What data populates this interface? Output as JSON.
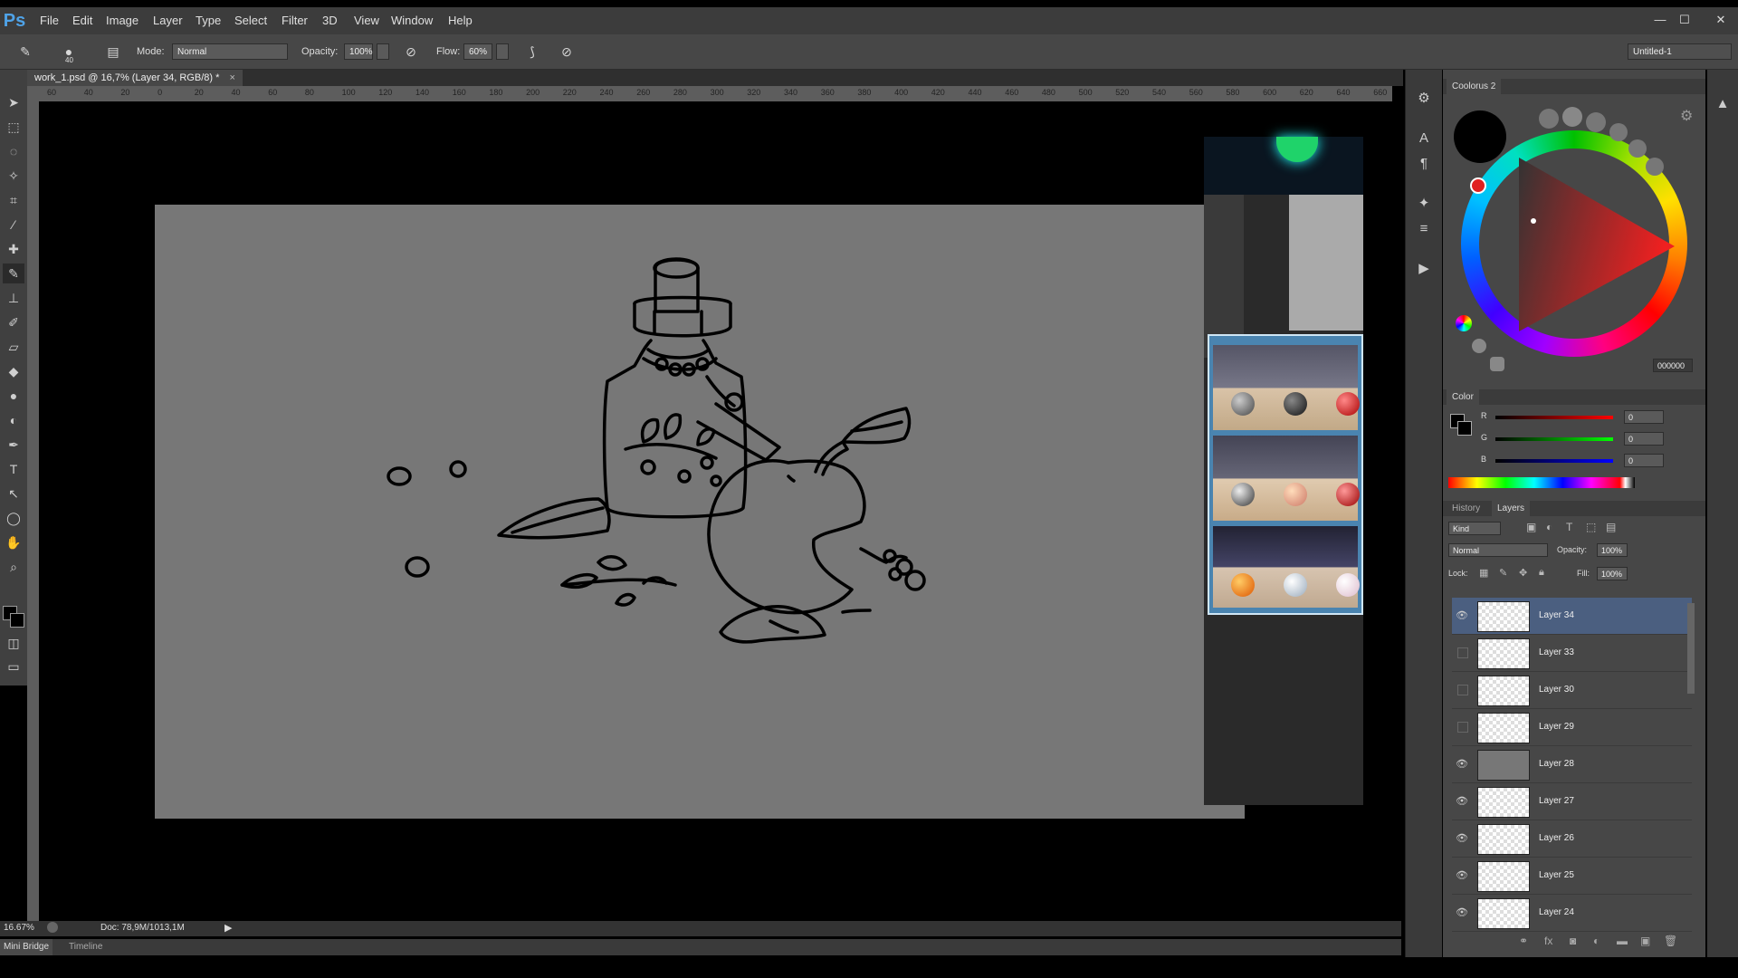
{
  "app": {
    "logo": "Ps"
  },
  "menu": [
    "File",
    "Edit",
    "Image",
    "Layer",
    "Type",
    "Select",
    "Filter",
    "3D",
    "View",
    "Window",
    "Help"
  ],
  "window_controls": {
    "minimize": "—",
    "maximize": "☐",
    "close": "✕"
  },
  "options": {
    "mode_label": "Mode:",
    "mode_value": "Normal",
    "opacity_label": "Opacity:",
    "opacity_value": "100%",
    "flow_label": "Flow:",
    "flow_value": "60%",
    "brush_size": "40",
    "workspace": "Untitled-1"
  },
  "document": {
    "tab_title": "work_1.psd @ 16,7% (Layer 34, RGB/8) *",
    "tab_close": "×"
  },
  "ruler_ticks": [
    "60",
    "40",
    "20",
    "0",
    "20",
    "40",
    "60",
    "80",
    "100",
    "120",
    "140",
    "160",
    "180",
    "200",
    "220",
    "240",
    "260",
    "280",
    "300",
    "320",
    "340",
    "360",
    "380",
    "400",
    "420",
    "440",
    "460",
    "480",
    "500",
    "520",
    "540",
    "560",
    "580",
    "600",
    "620",
    "640",
    "660"
  ],
  "status": {
    "zoom": "16.67%",
    "doc_info": "Doc: 78,9M/1013,1M"
  },
  "bottom_tabs": [
    "Mini Bridge",
    "Timeline"
  ],
  "coolorus": {
    "title": "Coolorus 2",
    "hex": "000000"
  },
  "color_panel": {
    "title": "Color",
    "channels": [
      {
        "label": "R",
        "value": "0",
        "color": "#e02020"
      },
      {
        "label": "G",
        "value": "0",
        "color": "#20c020"
      },
      {
        "label": "B",
        "value": "0",
        "color": "#2040e0"
      }
    ]
  },
  "layers_panel": {
    "tabs": [
      "History",
      "Layers"
    ],
    "kind": "Kind",
    "blend_mode": "Normal",
    "opacity_label": "Opacity:",
    "opacity_value": "100%",
    "lock_label": "Lock:",
    "fill_label": "Fill:",
    "fill_value": "100%",
    "layers": [
      {
        "name": "Layer 34",
        "visible": true,
        "selected": true
      },
      {
        "name": "Layer 33",
        "visible": false,
        "selected": false
      },
      {
        "name": "Layer 30",
        "visible": false,
        "selected": false
      },
      {
        "name": "Layer 29",
        "visible": false,
        "selected": false
      },
      {
        "name": "Layer 28",
        "visible": true,
        "selected": false
      },
      {
        "name": "Layer 27",
        "visible": true,
        "selected": false
      },
      {
        "name": "Layer 26",
        "visible": true,
        "selected": false
      },
      {
        "name": "Layer 25",
        "visible": true,
        "selected": false
      },
      {
        "name": "Layer 24",
        "visible": true,
        "selected": false
      }
    ]
  },
  "colors": {
    "panel_bg": "#474747",
    "selected_layer": "#4b5f80",
    "artboard": "#777777"
  }
}
